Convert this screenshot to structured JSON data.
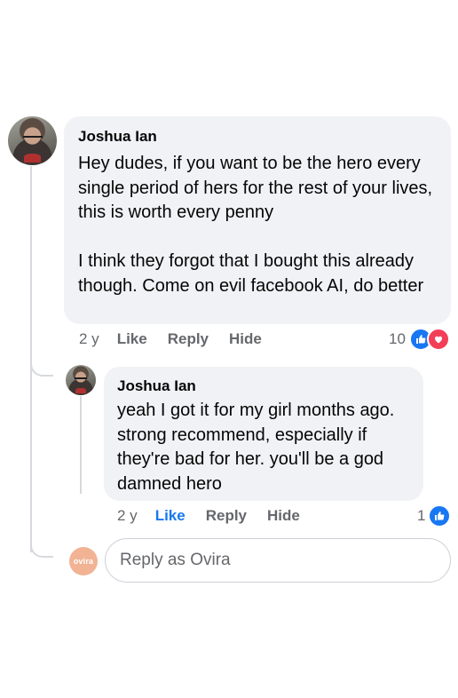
{
  "comment": {
    "author": "Joshua Ian",
    "text": "Hey dudes, if you want to be the hero every single period of hers for the rest of your lives, this is worth every penny\n\nI think they forgot that I bought this already though. Come on evil facebook AI, do better",
    "time": "2 y",
    "like_label": "Like",
    "reply_label": "Reply",
    "hide_label": "Hide",
    "reaction_count": "10",
    "reaction_icons": [
      "like-icon",
      "love-icon"
    ]
  },
  "reply": {
    "author": "Joshua Ian",
    "text": "yeah I got it for my girl months ago. strong recommend, especially if they're bad for her. you'll be a god damned hero",
    "time": "2 y",
    "like_label": "Like",
    "like_state": "liked",
    "reply_label": "Reply",
    "hide_label": "Hide",
    "reaction_count": "1",
    "reaction_icons": [
      "like-icon"
    ]
  },
  "reply_box": {
    "avatar_text": "ovira",
    "placeholder": "Reply as Ovira"
  },
  "colors": {
    "bubble_bg": "#f0f2f5",
    "secondary_text": "#65676b",
    "like_blue": "#1877f2",
    "love_red": "#f33e58",
    "ovira_avatar": "#f1b393"
  }
}
